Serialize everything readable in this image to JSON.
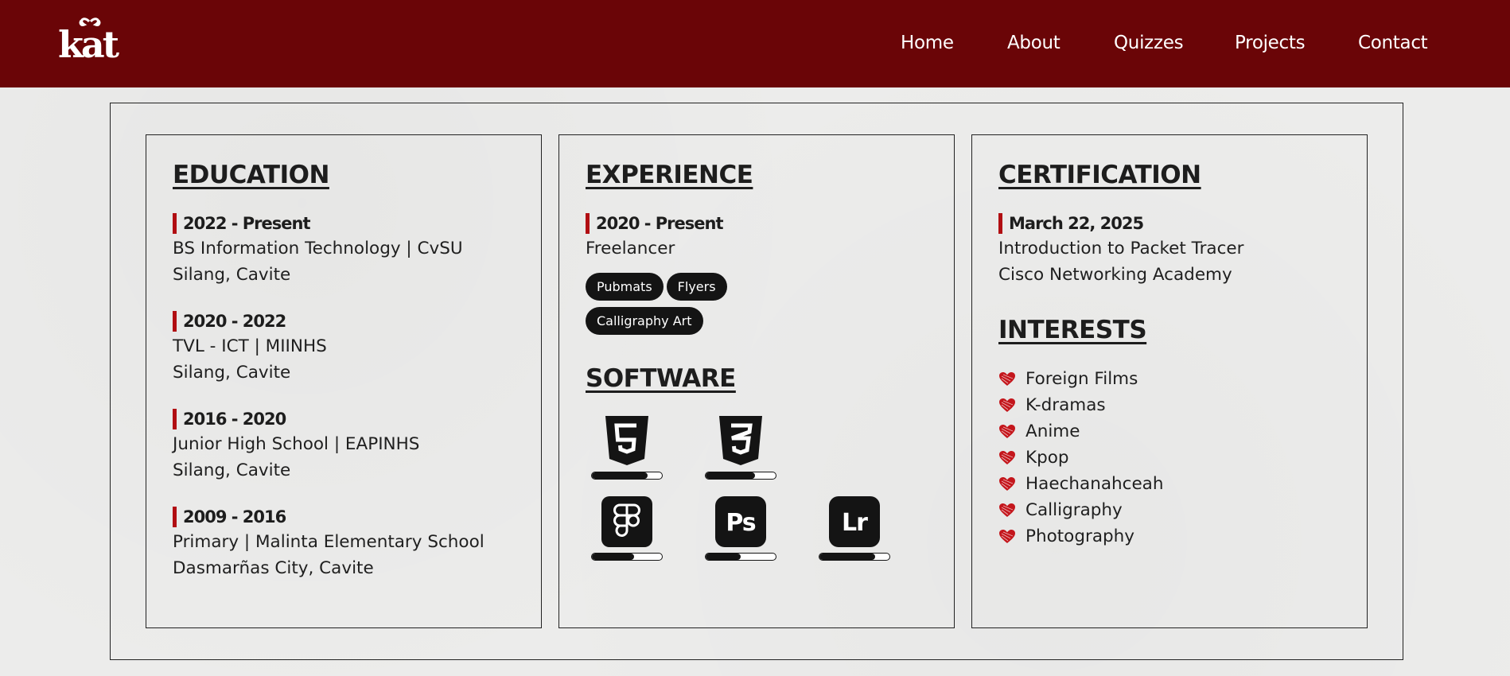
{
  "nav": {
    "logo_text": "kat",
    "links": [
      "Home",
      "About",
      "Quizzes",
      "Projects",
      "Contact"
    ]
  },
  "education": {
    "title": "EDUCATION",
    "entries": [
      {
        "date": "2022 - Present",
        "line1": "BS Information Technology | CvSU",
        "line2": "Silang, Cavite"
      },
      {
        "date": "2020 - 2022",
        "line1": "TVL - ICT | MIINHS",
        "line2": "Silang, Cavite"
      },
      {
        "date": "2016 - 2020",
        "line1": "Junior High School | EAPINHS",
        "line2": "Silang, Cavite"
      },
      {
        "date": "2009 - 2016",
        "line1": "Primary | Malinta Elementary School",
        "line2": "Dasmarñas City, Cavite"
      }
    ]
  },
  "experience": {
    "title": "EXPERIENCE",
    "date": "2020 - Present",
    "role": "Freelancer",
    "tags": [
      "Pubmats",
      "Flyers",
      "Calligraphy Art"
    ]
  },
  "software": {
    "title": "SOFTWARE",
    "items": [
      {
        "icon": "html5-icon",
        "level": 0.8
      },
      {
        "icon": "css3-icon",
        "level": 0.7
      },
      {
        "icon": "figma-icon",
        "level": 0.6
      },
      {
        "icon": "photoshop-icon",
        "level": 0.5
      },
      {
        "icon": "lightroom-icon",
        "level": 0.8
      }
    ],
    "ps_label": "Ps",
    "lr_label": "Lr"
  },
  "certification": {
    "title": "CERTIFICATION",
    "date": "March 22, 2025",
    "line1": "Introduction to Packet Tracer",
    "line2": "Cisco Networking Academy"
  },
  "interests": {
    "title": "INTERESTS",
    "items": [
      "Foreign Films",
      "K-dramas",
      "Anime",
      "Kpop",
      "Haechanahceah",
      "Calligraphy",
      "Photography"
    ]
  },
  "colors": {
    "nav_bg": "#6a0507",
    "accent_red": "#b10e12",
    "heart": "#c4161c",
    "dark": "#141414"
  }
}
